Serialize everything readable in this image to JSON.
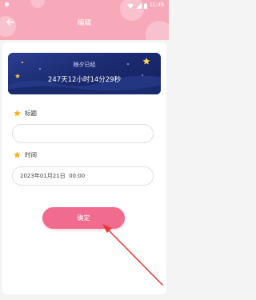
{
  "status_bar": {
    "time": "11:45"
  },
  "header": {
    "title": "编辑"
  },
  "banner": {
    "label": "除夕已经",
    "countdown": "247天12小时14分29秒"
  },
  "form": {
    "title_label": "标题",
    "title_value": "",
    "time_label": "时间",
    "time_value": "2023年01月21日  00:00"
  },
  "confirm_label": "确定",
  "colors": {
    "header_pink": "#f7a9ba",
    "button_pink": "#f06b8e",
    "star_yellow": "#f5b21b",
    "arrow_red": "#e53935",
    "banner_blue": "#1b2c73"
  },
  "icons": {
    "back": "arrow-left-icon",
    "wifi": "wifi-icon",
    "signal": "signal-icon",
    "battery": "battery-icon",
    "star": "star-icon"
  }
}
